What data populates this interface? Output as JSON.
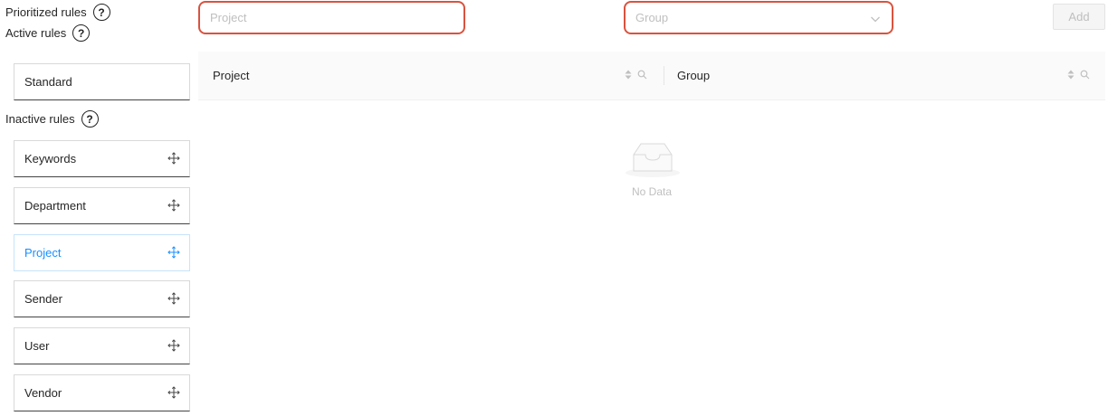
{
  "labels": {
    "prioritized": "Prioritized rules",
    "active": "Active rules",
    "inactive": "Inactive rules",
    "help_glyph": "?"
  },
  "active_rules": [
    "Standard"
  ],
  "inactive_rules": [
    {
      "label": "Keywords",
      "selected": false
    },
    {
      "label": "Department",
      "selected": false
    },
    {
      "label": "Project",
      "selected": true
    },
    {
      "label": "Sender",
      "selected": false
    },
    {
      "label": "User",
      "selected": false
    },
    {
      "label": "Vendor",
      "selected": false
    }
  ],
  "form": {
    "project_placeholder": "Project",
    "group_placeholder": "Group",
    "add_label": "Add"
  },
  "table": {
    "columns": [
      "Project",
      "Group"
    ],
    "empty_text": "No Data"
  },
  "colors": {
    "highlight_border": "#d9533f",
    "selected_text": "#1890ff"
  },
  "icons": {
    "help": "question-circle-icon",
    "drag": "drag-move-icon",
    "dropdown": "chevron-down-icon",
    "sort": "sort-icon",
    "filter": "search-icon",
    "empty": "empty-inbox-icon"
  }
}
